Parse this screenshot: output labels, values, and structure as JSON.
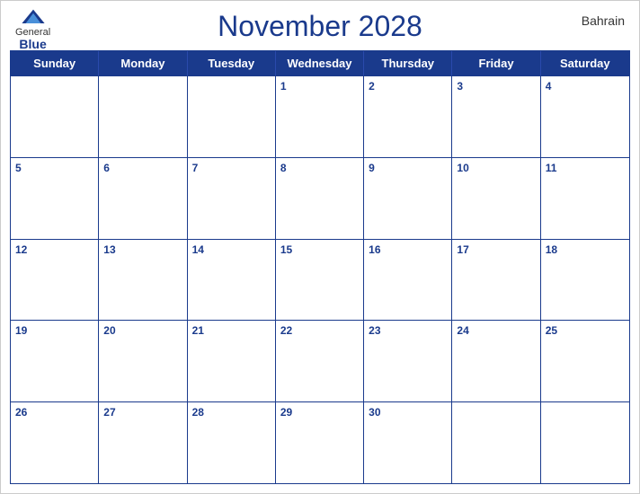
{
  "header": {
    "title": "November 2028",
    "country": "Bahrain",
    "logo": {
      "general": "General",
      "blue": "Blue"
    }
  },
  "dayHeaders": [
    "Sunday",
    "Monday",
    "Tuesday",
    "Wednesday",
    "Thursday",
    "Friday",
    "Saturday"
  ],
  "weeks": [
    [
      {
        "day": "",
        "empty": true
      },
      {
        "day": "",
        "empty": true
      },
      {
        "day": "",
        "empty": true
      },
      {
        "day": "1",
        "empty": false
      },
      {
        "day": "2",
        "empty": false
      },
      {
        "day": "3",
        "empty": false
      },
      {
        "day": "4",
        "empty": false
      }
    ],
    [
      {
        "day": "5",
        "empty": false
      },
      {
        "day": "6",
        "empty": false
      },
      {
        "day": "7",
        "empty": false
      },
      {
        "day": "8",
        "empty": false
      },
      {
        "day": "9",
        "empty": false
      },
      {
        "day": "10",
        "empty": false
      },
      {
        "day": "11",
        "empty": false
      }
    ],
    [
      {
        "day": "12",
        "empty": false
      },
      {
        "day": "13",
        "empty": false
      },
      {
        "day": "14",
        "empty": false
      },
      {
        "day": "15",
        "empty": false
      },
      {
        "day": "16",
        "empty": false
      },
      {
        "day": "17",
        "empty": false
      },
      {
        "day": "18",
        "empty": false
      }
    ],
    [
      {
        "day": "19",
        "empty": false
      },
      {
        "day": "20",
        "empty": false
      },
      {
        "day": "21",
        "empty": false
      },
      {
        "day": "22",
        "empty": false
      },
      {
        "day": "23",
        "empty": false
      },
      {
        "day": "24",
        "empty": false
      },
      {
        "day": "25",
        "empty": false
      }
    ],
    [
      {
        "day": "26",
        "empty": false
      },
      {
        "day": "27",
        "empty": false
      },
      {
        "day": "28",
        "empty": false
      },
      {
        "day": "29",
        "empty": false
      },
      {
        "day": "30",
        "empty": false
      },
      {
        "day": "",
        "empty": true
      },
      {
        "day": "",
        "empty": true
      }
    ]
  ],
  "colors": {
    "blue": "#1a3a8c",
    "white": "#ffffff"
  }
}
